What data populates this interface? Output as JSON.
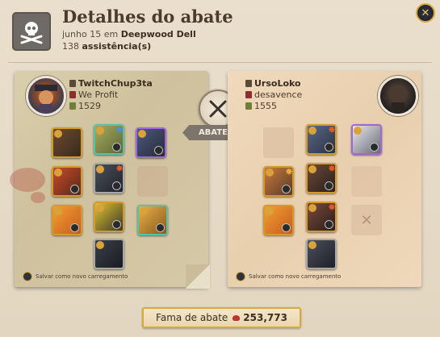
{
  "header": {
    "title": "Detalhes do abate",
    "date_prefix": "junho 15 em",
    "location": "Deepwood Dell",
    "assist_count": "138",
    "assist_label": "assistência(s)"
  },
  "left_player": {
    "name": "TwitchChup3ta",
    "guild": "We Profit",
    "item_power": "1529",
    "save_label": "Salvar como novo carregamento"
  },
  "right_player": {
    "name": "UrsoLoko",
    "guild": "desavence",
    "item_power": "1555",
    "save_label": "Salvar como novo carregamento"
  },
  "center": {
    "killed_label": "ABATEU"
  },
  "fame": {
    "label": "Fama de abate",
    "value": "253,773"
  },
  "colors": {
    "accent_gold": "#d9a93a",
    "rarity_purple": "#9e68d8",
    "rarity_teal": "#58c2a6",
    "kill_banner": "#7d756b"
  },
  "icons": [
    "skull-crossbones-icon",
    "close-icon",
    "crossed-swords-icon",
    "fame-gem-icon",
    "loadout-save-icon"
  ]
}
